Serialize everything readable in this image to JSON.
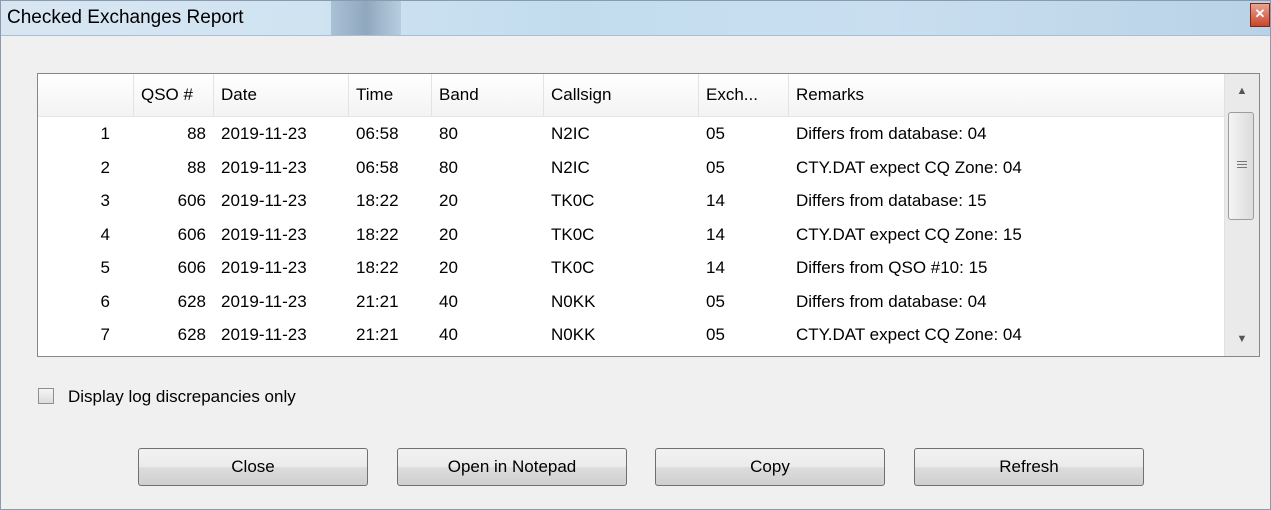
{
  "window": {
    "title": "Checked Exchanges Report",
    "close_glyph": "✕"
  },
  "columns": [
    "",
    "QSO #",
    "Date",
    "Time",
    "Band",
    "Callsign",
    "Exch...",
    "Remarks"
  ],
  "rows": [
    [
      "1",
      "88",
      "2019-11-23",
      "06:58",
      "80",
      "N2IC",
      "05",
      "Differs from database: 04"
    ],
    [
      "2",
      "88",
      "2019-11-23",
      "06:58",
      "80",
      "N2IC",
      "05",
      "CTY.DAT expect CQ Zone: 04"
    ],
    [
      "3",
      "606",
      "2019-11-23",
      "18:22",
      "20",
      "TK0C",
      "14",
      "Differs from database: 15"
    ],
    [
      "4",
      "606",
      "2019-11-23",
      "18:22",
      "20",
      "TK0C",
      "14",
      "CTY.DAT expect CQ Zone: 15"
    ],
    [
      "5",
      "606",
      "2019-11-23",
      "18:22",
      "20",
      "TK0C",
      "14",
      "Differs from QSO #10: 15"
    ],
    [
      "6",
      "628",
      "2019-11-23",
      "21:21",
      "40",
      "N0KK",
      "05",
      "Differs from database: 04"
    ],
    [
      "7",
      "628",
      "2019-11-23",
      "21:21",
      "40",
      "N0KK",
      "05",
      "CTY.DAT expect CQ Zone: 04"
    ]
  ],
  "scrollbar": {
    "up_glyph": "▲",
    "down_glyph": "▼"
  },
  "options": {
    "discrepancies_label": "Display log discrepancies only",
    "discrepancies_checked": false
  },
  "buttons": {
    "close": "Close",
    "open_notepad": "Open in Notepad",
    "copy": "Copy",
    "refresh": "Refresh"
  }
}
